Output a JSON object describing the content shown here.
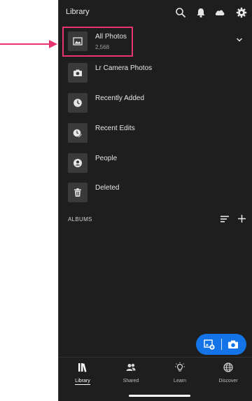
{
  "header": {
    "title": "Library",
    "icons": [
      "search-icon",
      "bell-icon",
      "cloud-icon",
      "gear-icon"
    ]
  },
  "library_items": [
    {
      "label": "All Photos",
      "sublabel": "2,568",
      "icon": "image-icon"
    },
    {
      "label": "Lr Camera Photos",
      "icon": "camera-icon"
    },
    {
      "label": "Recently Added",
      "icon": "clock-icon"
    },
    {
      "label": "Recent Edits",
      "icon": "edit-icon"
    },
    {
      "label": "People",
      "icon": "person-icon"
    },
    {
      "label": "Deleted",
      "icon": "trash-icon"
    }
  ],
  "albums": {
    "label": "ALBUMS"
  },
  "tabs": [
    {
      "label": "Library",
      "icon": "library-icon",
      "active": true
    },
    {
      "label": "Shared",
      "icon": "people-icon"
    },
    {
      "label": "Learn",
      "icon": "lightbulb-icon"
    },
    {
      "label": "Discover",
      "icon": "globe-icon"
    }
  ],
  "colors": {
    "background": "#1e1e1e",
    "accent": "#1473e6",
    "highlight": "#e8346f"
  }
}
